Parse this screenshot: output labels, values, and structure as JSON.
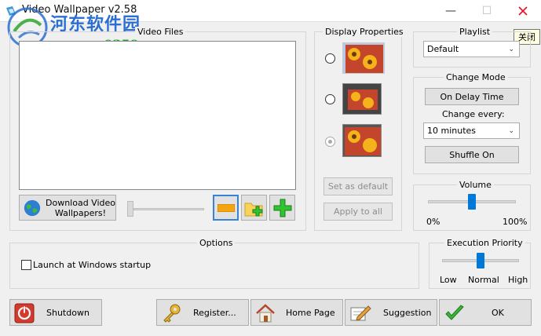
{
  "window": {
    "title": "Video Wallpaper  v2.58",
    "watermark_line1": "河东软件园",
    "watermark_line2": "www.pc0359.cn",
    "tooltip": "关闭"
  },
  "video_files": {
    "label": "Video Files",
    "download_button": "Download Video\nWallpapers!"
  },
  "display_properties": {
    "label": "Display Properties",
    "set_default": "Set as default",
    "apply_all": "Apply to all"
  },
  "playlist": {
    "label": "Playlist",
    "selected": "Default"
  },
  "change_mode": {
    "label": "Change Mode",
    "mode_button": "On Delay Time",
    "every_label": "Change every:",
    "interval": "10 minutes",
    "shuffle_button": "Shuffle On"
  },
  "volume": {
    "label": "Volume",
    "min": "0%",
    "max": "100%",
    "level": 0.5
  },
  "options": {
    "label": "Options",
    "launch_startup": "Launch at Windows startup"
  },
  "priority": {
    "label": "Execution Priority",
    "low": "Low",
    "normal": "Normal",
    "high": "High"
  },
  "bottom": {
    "shutdown": "Shutdown",
    "register": "Register...",
    "home": "Home Page",
    "suggestion": "Suggestion",
    "ok": "OK"
  },
  "colors": {
    "accent": "#0078d7",
    "close_red": "#e81123"
  }
}
